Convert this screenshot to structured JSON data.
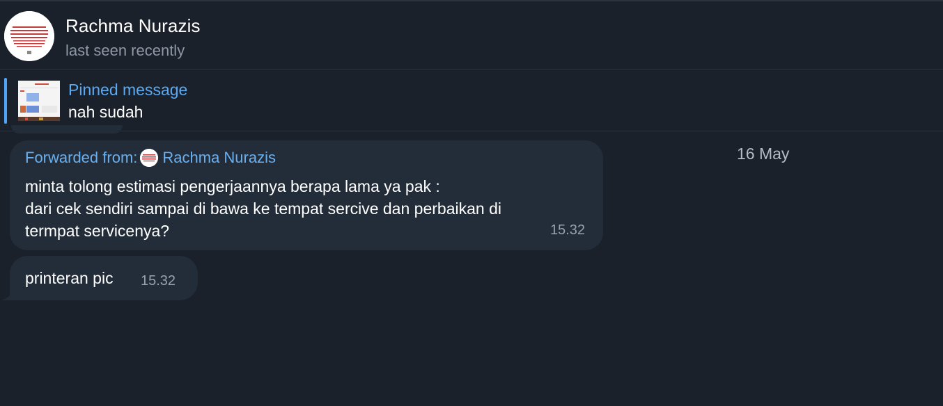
{
  "header": {
    "contact_name": "Rachma Nurazis",
    "status": "last seen recently",
    "avatar_icon": "profile-picture"
  },
  "pinned": {
    "label": "Pinned message",
    "text": "nah sudah",
    "thumb_icon": "document-thumbnail"
  },
  "chat": {
    "date": "16 May",
    "messages": [
      {
        "forwarded_label": "Forwarded from:",
        "forwarded_name": "Rachma Nurazis",
        "text": "minta tolong estimasi pengerjaannya berapa lama ya pak :\ndari cek sendiri sampai di bawa ke tempat sercive dan perbaikan di\ntermpat servicenya?",
        "time": "15.32"
      },
      {
        "text": "printeran pic",
        "time": "15.32"
      }
    ]
  },
  "colors": {
    "background": "#1b212a",
    "bubble": "#232d3a",
    "accent": "#4ea4f6",
    "secondary_text": "#8e98a6"
  }
}
